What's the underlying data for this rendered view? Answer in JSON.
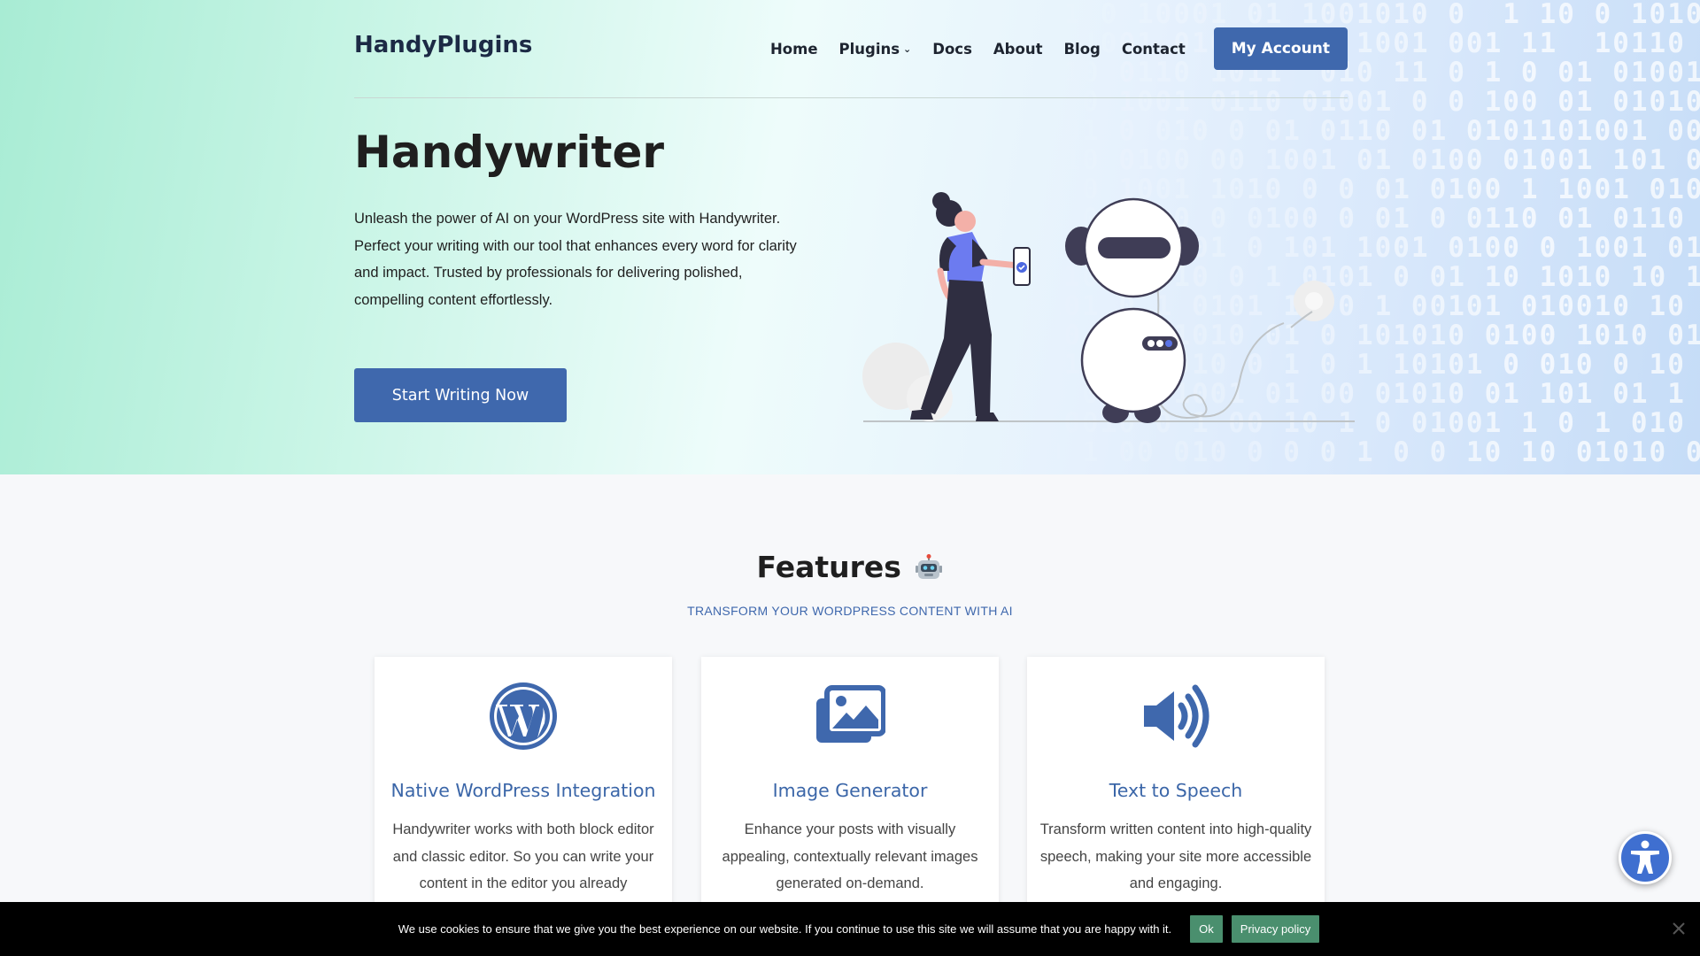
{
  "header": {
    "logo": "HandyPlugins",
    "nav": [
      {
        "label": "Home"
      },
      {
        "label": "Plugins"
      },
      {
        "label": "Docs"
      },
      {
        "label": "About"
      },
      {
        "label": "Blog"
      },
      {
        "label": "Contact"
      }
    ],
    "account_button": "My Account"
  },
  "hero": {
    "title": "Handywriter",
    "description": "Unleash the power of AI on your WordPress site with Handywriter. Perfect your writing with our tool that enhances every word for clarity and impact. Trusted by professionals for delivering polished, compelling content effortlessly.",
    "cta": "Start Writing Now"
  },
  "features": {
    "title": "Features",
    "subtitle": "TRANSFORM YOUR WORDPRESS CONTENT WITH AI",
    "cards": [
      {
        "icon": "wordpress-icon",
        "title": "Native WordPress Integration",
        "text": "Handywriter works with both block editor and classic editor. So you can write your content in the editor you already"
      },
      {
        "icon": "image-icon",
        "title": "Image Generator",
        "text": "Enhance your posts with visually appealing, contextually relevant images generated on-demand."
      },
      {
        "icon": "speaker-icon",
        "title": "Text to Speech",
        "text": "Transform written content into high-quality speech, making your site more accessible and engaging."
      }
    ]
  },
  "cookie_bar": {
    "text": "We use cookies to ensure that we give you the best experience on our website. If you continue to use this site we will assume that you are happy with it.",
    "ok": "Ok",
    "privacy": "Privacy policy"
  },
  "colors": {
    "accent": "#3f68ad",
    "cookie_button": "#4a8f6e"
  }
}
